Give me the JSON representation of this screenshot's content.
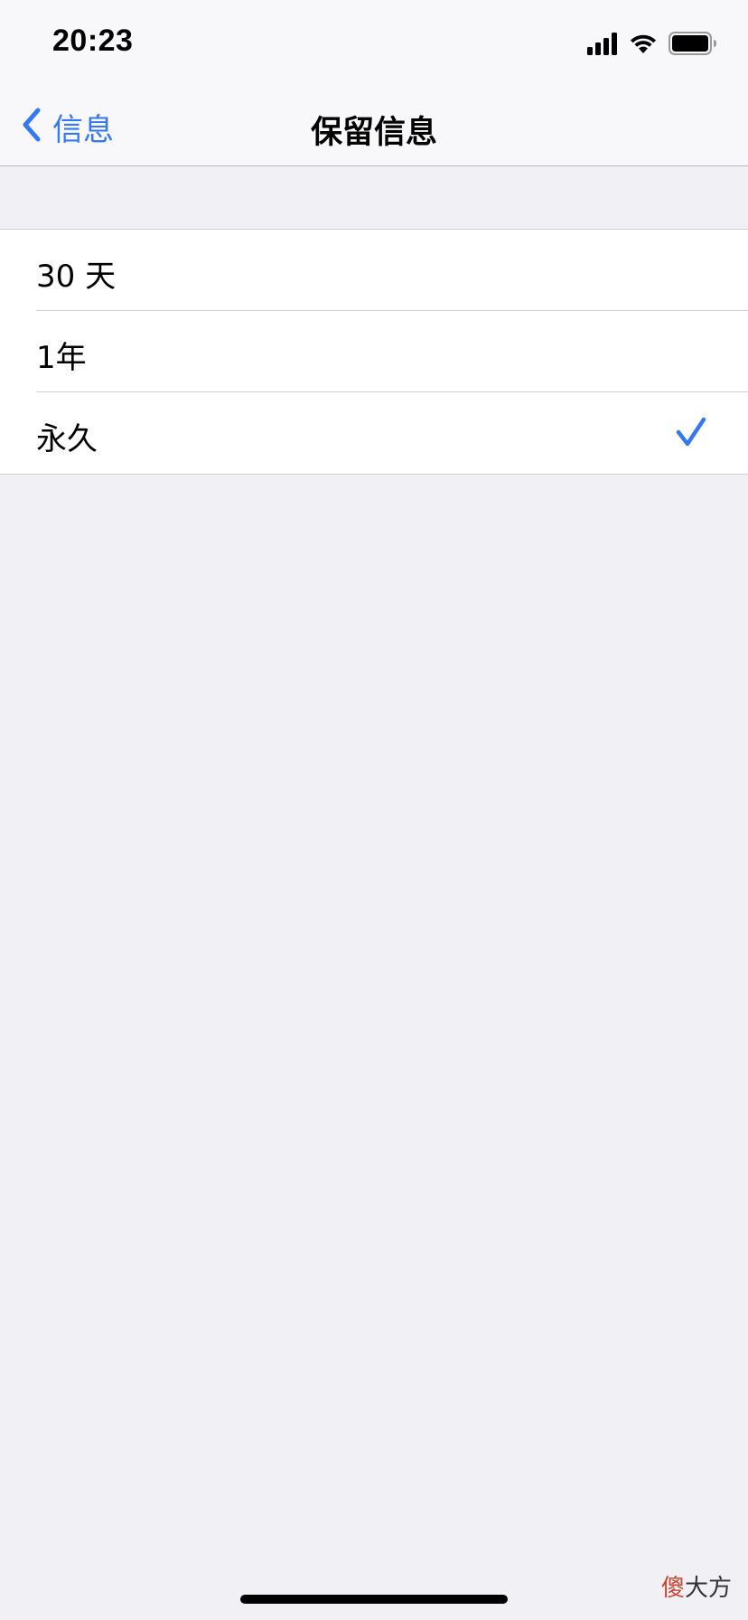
{
  "status_bar": {
    "time": "20:23",
    "icons": [
      "cellular-signal-icon",
      "wifi-icon",
      "battery-icon"
    ]
  },
  "nav": {
    "back_label": "信息",
    "title": "保留信息"
  },
  "options": [
    {
      "label": "30 天",
      "selected": false
    },
    {
      "label": "1年",
      "selected": false
    },
    {
      "label": "永久",
      "selected": true
    }
  ],
  "watermark": {
    "part1": "傻",
    "part2": "大方"
  },
  "colors": {
    "accent": "#3478f6",
    "background": "#f0f0f5",
    "cell": "#ffffff",
    "watermark_red": "#c9432e"
  }
}
